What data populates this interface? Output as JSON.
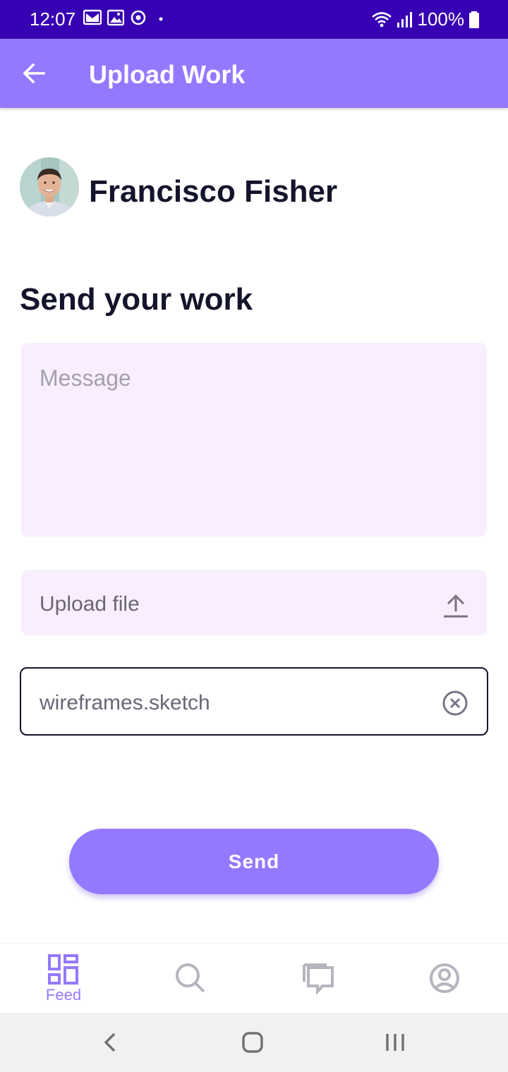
{
  "status_bar": {
    "time": "12:07",
    "battery": "100%",
    "left_icons": [
      "gmail-icon",
      "gallery-icon",
      "sync-icon",
      "dot-icon"
    ],
    "right_icons": [
      "wifi-icon",
      "signal-icon",
      "battery-icon"
    ]
  },
  "app_bar": {
    "title": "Upload Work",
    "back_icon": "arrow-left-icon"
  },
  "profile": {
    "name": "Francisco Fisher"
  },
  "form": {
    "heading": "Send your work",
    "message_placeholder": "Message",
    "message_value": "",
    "upload_label": "Upload file",
    "upload_icon": "upload-icon",
    "attached_file": "wireframes.sketch",
    "clear_icon": "clear-circle-icon",
    "send_label": "Send"
  },
  "bottom_nav": {
    "items": [
      {
        "label": "Feed",
        "icon": "feed-icon",
        "active": true
      },
      {
        "label": "",
        "icon": "search-icon",
        "active": false
      },
      {
        "label": "",
        "icon": "chat-icon",
        "active": false
      },
      {
        "label": "",
        "icon": "profile-icon",
        "active": false
      }
    ]
  },
  "system_nav": [
    "back-icon",
    "home-icon",
    "recents-icon"
  ],
  "colors": {
    "status_bar": "#3700b3",
    "primary": "#9479ff",
    "field_background": "#f9eefe",
    "text_dark": "#14142b",
    "text_muted": "#6b6577",
    "inactive_icon": "#b8b4bf"
  }
}
